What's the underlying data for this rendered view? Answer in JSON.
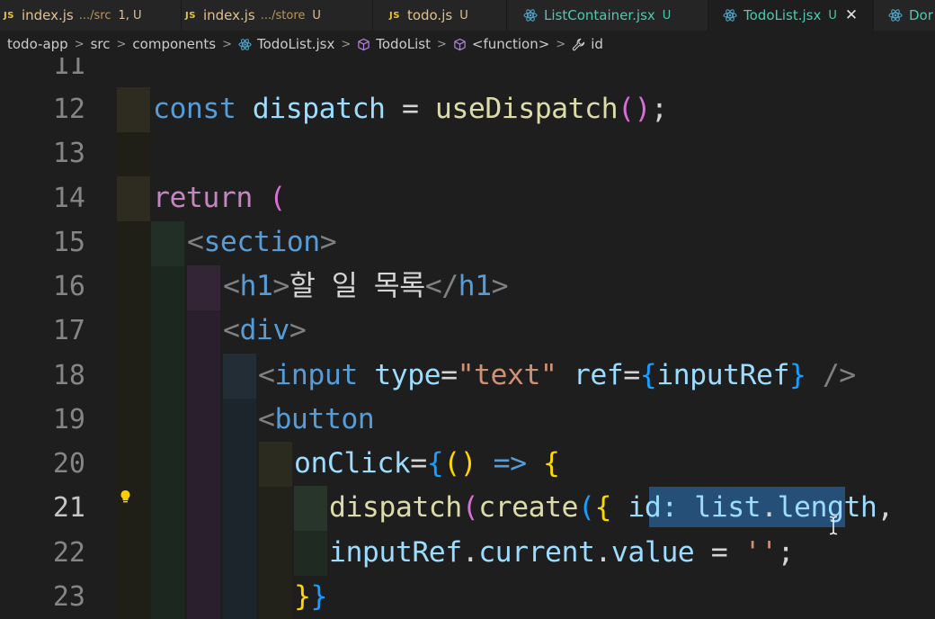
{
  "tabs": [
    {
      "name": "index.js",
      "path": ".../src",
      "status": "1, U",
      "kind": "js",
      "active": false
    },
    {
      "name": "index.js",
      "path": ".../store",
      "status": "U",
      "kind": "js",
      "active": false
    },
    {
      "name": "todo.js",
      "path": "",
      "status": "U",
      "kind": "js",
      "active": false
    },
    {
      "name": "ListContainer.jsx",
      "path": "",
      "status": "U",
      "kind": "react",
      "active": false
    },
    {
      "name": "TodoList.jsx",
      "path": "",
      "status": "U",
      "kind": "react",
      "active": true
    },
    {
      "name": "Dor",
      "path": "",
      "status": "",
      "kind": "react",
      "active": false
    }
  ],
  "tab_js_badge": "JS",
  "tab_close_glyph": "✕",
  "breadcrumb": {
    "items": [
      "todo-app",
      "src",
      "components",
      "TodoList.jsx",
      "TodoList",
      "<function>",
      "id"
    ],
    "separator": ">"
  },
  "editor": {
    "line_numbers": [
      "11",
      "12",
      "13",
      "14",
      "15",
      "16",
      "17",
      "18",
      "19",
      "20",
      "21",
      "22",
      "23"
    ],
    "current_line": "21",
    "selected_text": "id: list.le"
  },
  "code": {
    "l12": {
      "const": "const",
      "name": " dispatch ",
      "eq": "= ",
      "fn": "useDispatch",
      "open": "(",
      "close": ")",
      "semi": ";"
    },
    "l14": {
      "ret": "return",
      "paren": " ("
    },
    "l15": {
      "lt": "<",
      "tag": "section",
      "gt": ">"
    },
    "l16": {
      "lt": "<",
      "tag": "h1",
      "gt": ">",
      "text": "할 일 목록",
      "lt2": "</",
      "tag2": "h1",
      "gt2": ">"
    },
    "l17": {
      "lt": "<",
      "tag": "div",
      "gt": ">"
    },
    "l18": {
      "lt": "<",
      "tag": "input",
      "attr1": " type",
      "eq1": "=",
      "val1": "\"text\"",
      "attr2": " ref",
      "eq2": "=",
      "open": "{",
      "val2": "inputRef",
      "close": "}",
      "end": " />"
    },
    "l19": {
      "lt": "<",
      "tag": "button"
    },
    "l20": {
      "attr": "onClick",
      "eq": "=",
      "open": "{",
      "p1": "(",
      "p2": ")",
      "arrow": " => ",
      "brace": "{"
    },
    "l21": {
      "fn1": "dispatch",
      "p1": "(",
      "fn2": "create",
      "p2": "(",
      "b": "{",
      "sp": " ",
      "key": "id",
      "colon": ":",
      "sp2": " ",
      "obj": "list",
      "dot": ".",
      "prop": "length",
      "comma": ","
    },
    "l22": {
      "obj": "inputRef",
      "dot1": ".",
      "p1": "current",
      "dot2": ".",
      "p2": "value",
      "eq": " = ",
      "str": "''",
      "semi": ";"
    },
    "l23": {
      "c1": "}",
      "c2": "}"
    }
  },
  "colors": {
    "keyword": "#569cd6",
    "control": "#c586c0",
    "variable": "#9cdcfe",
    "function": "#dcdcaa",
    "string": "#ce9178",
    "selection": "#264f78",
    "modified": "#e2c08d",
    "untracked": "#4ec9b0"
  },
  "icons": {
    "react": "react-icon",
    "cube": "symbol-cube-icon",
    "wrench": "wrench-icon",
    "lightbulb": "lightbulb-icon"
  }
}
